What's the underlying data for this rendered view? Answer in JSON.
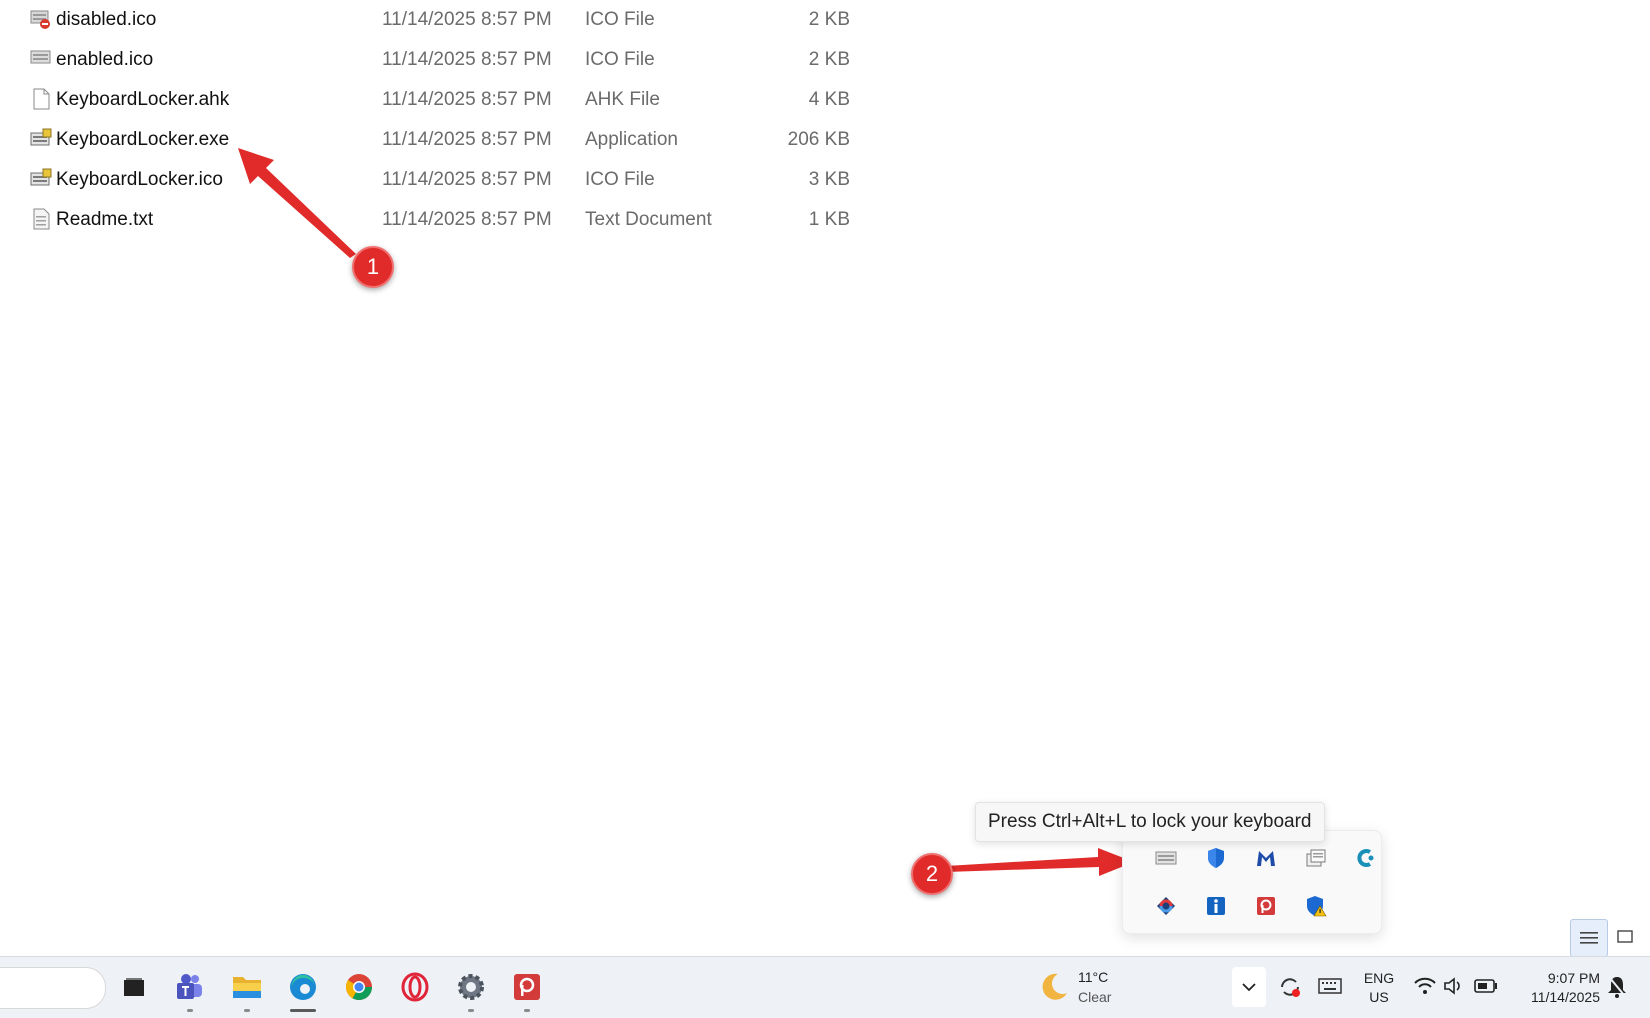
{
  "files": [
    {
      "name": "disabled.ico",
      "date": "11/14/2025 8:57 PM",
      "type": "ICO File",
      "size": "2 KB",
      "icon": "ico-disabled-icon"
    },
    {
      "name": "enabled.ico",
      "date": "11/14/2025 8:57 PM",
      "type": "ICO File",
      "size": "2 KB",
      "icon": "ico-enabled-icon"
    },
    {
      "name": "KeyboardLocker.ahk",
      "date": "11/14/2025 8:57 PM",
      "type": "AHK File",
      "size": "4 KB",
      "icon": "blank-file-icon"
    },
    {
      "name": "KeyboardLocker.exe",
      "date": "11/14/2025 8:57 PM",
      "type": "Application",
      "size": "206 KB",
      "icon": "keyboard-locker-app-icon"
    },
    {
      "name": "KeyboardLocker.ico",
      "date": "11/14/2025 8:57 PM",
      "type": "ICO File",
      "size": "3 KB",
      "icon": "keyboard-locker-ico-icon"
    },
    {
      "name": "Readme.txt",
      "date": "11/14/2025 8:57 PM",
      "type": "Text Document",
      "size": "1 KB",
      "icon": "text-file-icon"
    }
  ],
  "annotations": {
    "badge1": "1",
    "badge2": "2",
    "color": "#e12a2a"
  },
  "tray": {
    "tooltip": "Press Ctrl+Alt+L to lock your keyboard",
    "icons_row1": [
      "keyboard-locker-tray-icon",
      "defender-shield-icon",
      "malwarebytes-icon",
      "network-monitor-icon",
      "copilot-icon"
    ],
    "icons_row2": [
      "sync-app-icon",
      "info-icon",
      "pocket-app-icon",
      "security-warning-icon"
    ]
  },
  "taskbar": {
    "apps": [
      "task-view-icon",
      "teams-icon",
      "file-explorer-icon",
      "edge-icon",
      "chrome-icon",
      "opera-icon",
      "settings-icon",
      "pocket-app-icon"
    ],
    "weather_temp": "11°C",
    "weather_condition": "Clear",
    "lang_line1": "ENG",
    "lang_line2": "US",
    "time": "9:07 PM",
    "date": "11/14/2025"
  }
}
